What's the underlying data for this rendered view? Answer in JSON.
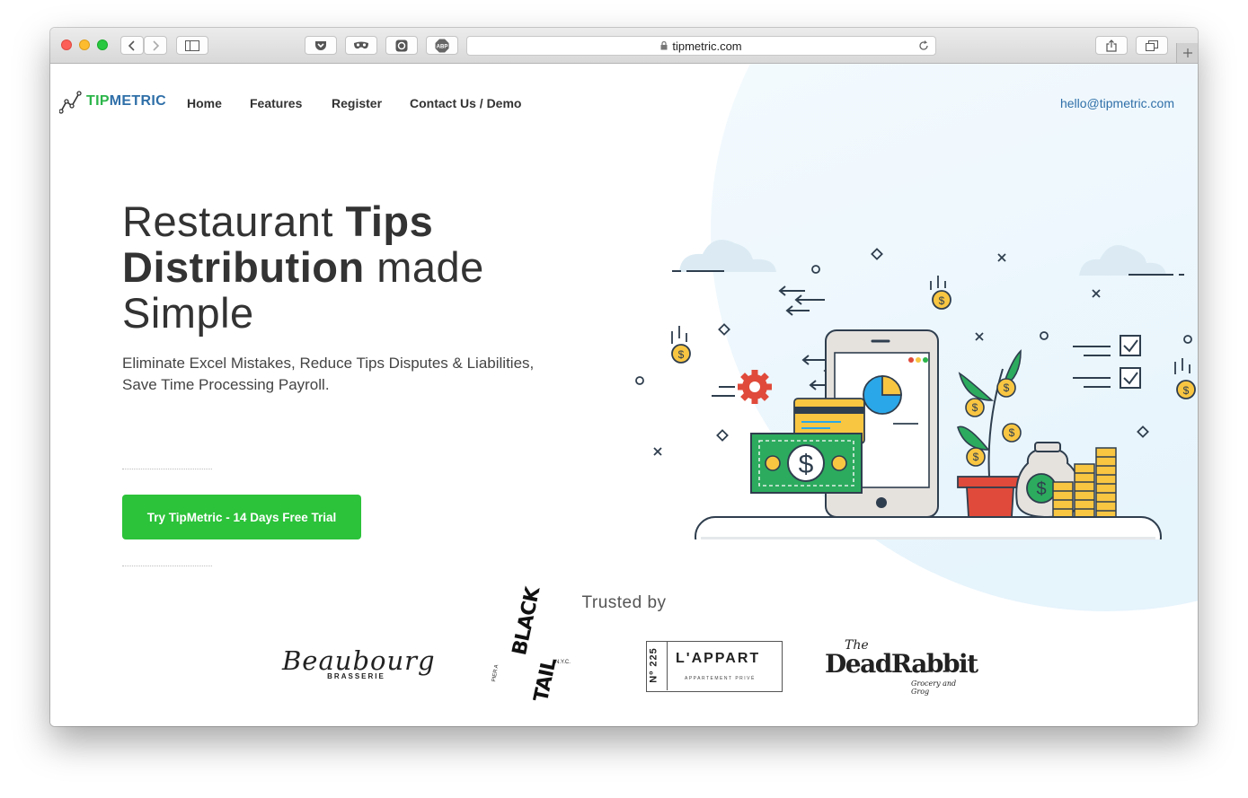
{
  "browser": {
    "url": "tipmetric.com",
    "icons": [
      "back-icon",
      "forward-icon",
      "sidebar-icon",
      "pocket-icon",
      "mask-icon",
      "record-icon",
      "abp-icon",
      "reload-icon",
      "share-icon",
      "tabs-icon",
      "new-tab-icon"
    ],
    "abp_label": "ABP"
  },
  "header": {
    "logo_tip": "TIP",
    "logo_metric": "METRIC",
    "nav": [
      "Home",
      "Features",
      "Register",
      "Contact Us / Demo"
    ],
    "email": "hello@tipmetric.com"
  },
  "hero": {
    "title_part1": "Restaurant ",
    "title_bold1": "Tips",
    "title_bold2": "Distribution",
    "title_part2": " made",
    "title_part3": "Simple",
    "subtitle": "Eliminate Excel Mistakes, Reduce Tips Disputes & Liabilities, Save Time Processing Payroll.",
    "cta": "Try TipMetric - 14 Days Free Trial"
  },
  "trusted": {
    "heading": "Trusted by",
    "logos": [
      {
        "name": "Beaubourg",
        "sub": "BRASSERIE"
      },
      {
        "name_top": "BLACK",
        "name_bottom": "TAIL",
        "side": "PIER A",
        "tag": "N.Y.C."
      },
      {
        "no": "Nº 225",
        "name": "L'APPART",
        "sub": "APPARTEMENT PRIVÉ"
      },
      {
        "the": "The",
        "name": "DeadRabbit",
        "sub": "Grocery and Grog"
      }
    ]
  },
  "colors": {
    "brand_green": "#2cc23a",
    "brand_blue": "#2f6fa8",
    "text_dark": "#333333",
    "link_blue": "#2f6fa8"
  }
}
